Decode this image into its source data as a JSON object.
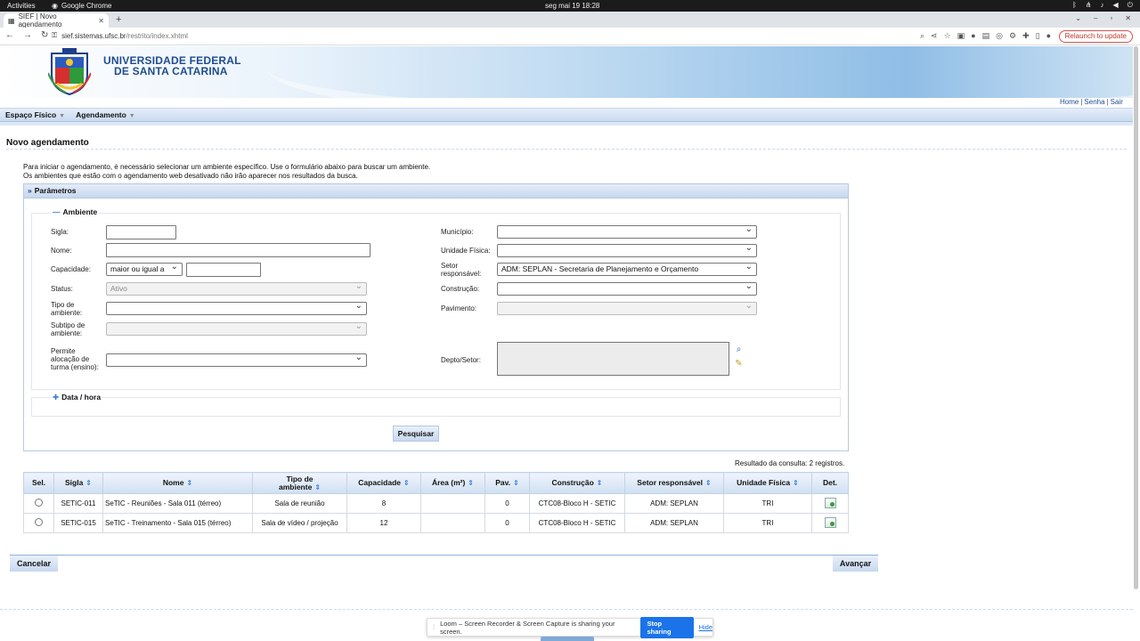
{
  "os": {
    "activities": "Activities",
    "app_name": "Google Chrome",
    "clock": "seg mai 19  18:28"
  },
  "browser": {
    "tab_title": "SIEF | Novo agendamento",
    "url_domain": "sief.sistemas.ufsc.br",
    "url_path": "/restrito/index.xhtml",
    "relaunch": "Relaunch to update"
  },
  "header": {
    "university_line1": "UNIVERSIDADE FEDERAL",
    "university_line2": "DE SANTA CATARINA",
    "links": {
      "home": "Home",
      "senha": "Senha",
      "sair": "Sair",
      "sep": "|"
    }
  },
  "menu": {
    "espaco": "Espaço Físico",
    "agendamento": "Agendamento"
  },
  "page": {
    "title": "Novo agendamento",
    "intro1": "Para iniciar o agendamento, é necessário selecionar um ambiente específico. Use o formulário abaixo para buscar um ambiente.",
    "intro2": "Os ambientes que estão com o agendamento web desativado não irão aparecer nos resultados da busca."
  },
  "panel": {
    "title": "Parâmetros",
    "ambiente_legend": "Ambiente",
    "data_legend": "Data / hora"
  },
  "form": {
    "sigla": "Sigla:",
    "nome": "Nome:",
    "capacidade": "Capacidade:",
    "capacidade_op": "maior ou igual a",
    "status": "Status:",
    "status_value": "Ativo",
    "tipo1": "Tipo de",
    "tipo2": "ambiente:",
    "subtipo1": "Subtipo de",
    "subtipo2": "ambiente:",
    "permite1": "Permite",
    "permite2": "alocação de",
    "permite3": "turma (ensino):",
    "municipio": "Município:",
    "unidade": "Unidade Física:",
    "setor1": "Setor",
    "setor2": "responsável:",
    "setor_value": "ADM: SEPLAN - Secretaria de Planejamento e Orçamento",
    "construcao": "Construção:",
    "pavimento": "Pavimento:",
    "depto": "Depto/Setor:"
  },
  "search_button": "Pesquisar",
  "result_text": "Resultado da consulta: 2 registros.",
  "table": {
    "headers": {
      "sel": "Sel.",
      "sigla": "Sigla",
      "nome": "Nome",
      "tipo1": "Tipo de",
      "tipo2": "ambiente",
      "capacidade": "Capacidade",
      "area": "Área (m²)",
      "pav": "Pav.",
      "construcao": "Construção",
      "setor": "Setor responsável",
      "unidade": "Unidade Física",
      "det": "Det."
    },
    "rows": [
      {
        "sigla": "SETIC-011",
        "nome": "SeTIC - Reuniões - Sala 011 (térreo)",
        "tipo": "Sala de reunião",
        "capacidade": "8",
        "area": "",
        "pav": "0",
        "construcao": "CTC08-Bloco H - SETIC",
        "setor": "ADM: SEPLAN",
        "unidade": "TRI"
      },
      {
        "sigla": "SETIC-015",
        "nome": "SeTIC - Treinamento - Sala 015 (térreo)",
        "tipo": "Sala de vídeo / projeção",
        "capacidade": "12",
        "area": "",
        "pav": "0",
        "construcao": "CTC08-Bloco H - SETIC",
        "setor": "ADM: SEPLAN",
        "unidade": "TRI"
      }
    ]
  },
  "nav": {
    "cancel": "Cancelar",
    "next": "Avançar"
  },
  "loom": {
    "message": "Loom – Screen Recorder & Screen Capture is sharing your screen.",
    "stop": "Stop sharing",
    "hide": "Hide"
  }
}
